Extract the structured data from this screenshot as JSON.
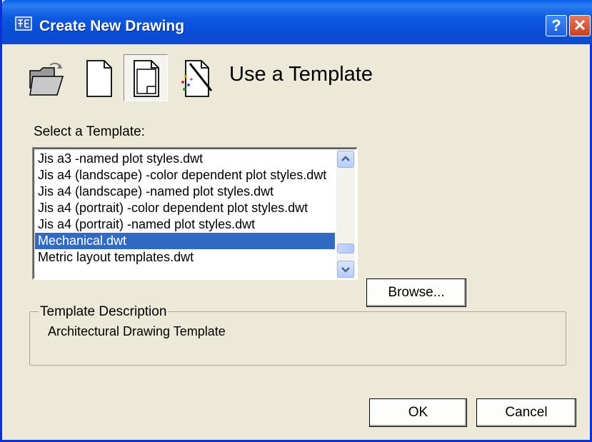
{
  "window": {
    "title": "Create New Drawing",
    "help_label": "?",
    "close_label": "✕"
  },
  "toolbar": {
    "buttons": [
      {
        "name": "open-drawing",
        "icon": "open-folder-icon",
        "pressed": false
      },
      {
        "name": "start-from-scratch",
        "icon": "blank-page-icon",
        "pressed": false
      },
      {
        "name": "use-a-template",
        "icon": "template-page-icon",
        "pressed": true
      },
      {
        "name": "use-a-wizard",
        "icon": "wizard-wand-icon",
        "pressed": false
      }
    ]
  },
  "heading": "Use a Template",
  "template_list": {
    "label": "Select a Template:",
    "items": [
      "Jis a3 -named plot styles.dwt",
      "Jis a4 (landscape) -color dependent plot styles.dwt",
      "Jis a4 (landscape) -named plot styles.dwt",
      "Jis a4 (portrait) -color dependent plot styles.dwt",
      "Jis a4 (portrait) -named plot styles.dwt",
      "Mechanical.dwt",
      "Metric layout templates.dwt"
    ],
    "selected": "Mechanical.dwt"
  },
  "browse_label": "Browse...",
  "description": {
    "title": "Template Description",
    "text": "Architectural Drawing Template"
  },
  "ok_label": "OK",
  "cancel_label": "Cancel",
  "colors": {
    "titlebar": "#0a4ed8",
    "selection": "#316ac5",
    "dialog_bg": "#ece9d8"
  }
}
